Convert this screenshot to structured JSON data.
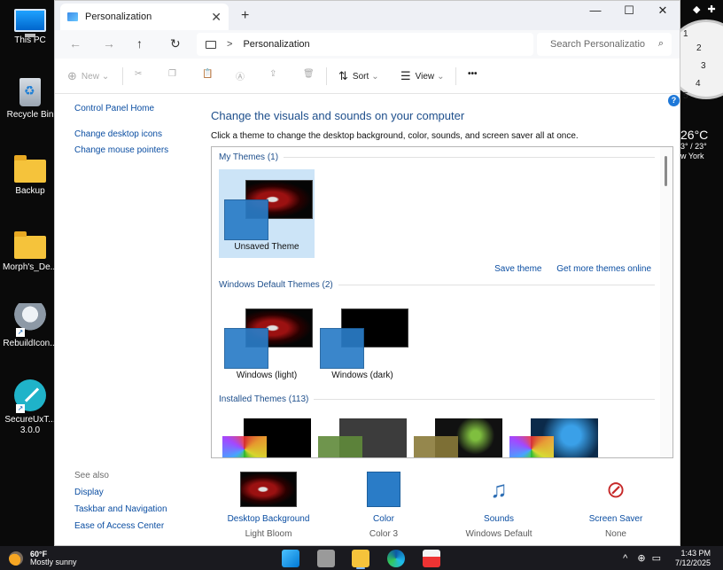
{
  "desktop": {
    "icons": [
      {
        "label": "This PC"
      },
      {
        "label": "Recycle Bin"
      },
      {
        "label": "Backup"
      },
      {
        "label": "Morph's_De..."
      },
      {
        "label": "RebuildIcon..."
      },
      {
        "label": "SecureUxT...",
        "label2": "3.0.0"
      }
    ],
    "clock_numbers": [
      "1",
      "2",
      "3",
      "4",
      "5"
    ],
    "weather_widget": {
      "temp": "26°C",
      "range": "3° / 23°",
      "city": "w York"
    }
  },
  "window": {
    "tab_title": "Personalization",
    "tab_close": "✕",
    "new_tab": "+",
    "controls": {
      "minimize": "—",
      "maximize": "☐",
      "close": "✕"
    },
    "nav": {
      "back": "←",
      "forward": "→",
      "up": "↑",
      "refresh": "↻"
    },
    "address": {
      "separator": ">",
      "path": "Personalization"
    },
    "search": {
      "placeholder": "Search Personalizatio",
      "icon": "⌕"
    },
    "toolbar": {
      "new_label": "New",
      "sort_label": "Sort",
      "view_label": "View",
      "more_label": "•••"
    },
    "help": "?"
  },
  "left_nav": {
    "home": "Control Panel Home",
    "links": [
      "Change desktop icons",
      "Change mouse pointers"
    ]
  },
  "see_also": {
    "header": "See also",
    "links": [
      "Display",
      "Taskbar and Navigation",
      "Ease of Access Center"
    ]
  },
  "main": {
    "title": "Change the visuals and sounds on your computer",
    "subtitle": "Click a theme to change the desktop background, color, sounds, and screen saver all at once.",
    "groups": {
      "my_themes": "My Themes (1)",
      "default_themes": "Windows Default Themes (2)",
      "installed_themes": "Installed Themes (113)"
    },
    "my_themes": [
      {
        "label": "Unsaved Theme"
      }
    ],
    "default_themes": [
      {
        "label": "Windows (light)"
      },
      {
        "label": "Windows (dark)"
      }
    ],
    "links": {
      "save": "Save theme",
      "more": "Get more themes online"
    }
  },
  "options": [
    {
      "name": "Desktop Background",
      "value": "Light Bloom"
    },
    {
      "name": "Color",
      "value": "Color 3"
    },
    {
      "name": "Sounds",
      "value": "Windows Default"
    },
    {
      "name": "Screen Saver",
      "value": "None"
    }
  ],
  "taskbar": {
    "weather_temp": "60°F",
    "weather_desc": "Mostly sunny",
    "tray_chevron": "^",
    "time": "1:43 PM",
    "date": "7/12/2025"
  },
  "colors": {
    "link": "#0b4ea2",
    "title": "#1e4f8c",
    "selected": "#cce4f7",
    "accent": "#2a7cc7"
  }
}
